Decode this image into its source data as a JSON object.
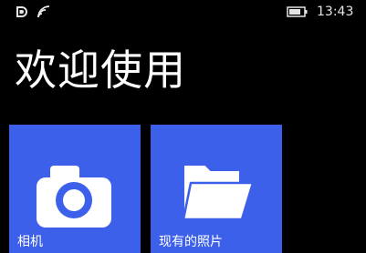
{
  "status_bar": {
    "icons": [
      "nfc-icon",
      "wifi-icon",
      "battery-icon"
    ],
    "time": "13:43"
  },
  "page": {
    "title": "欢迎使用"
  },
  "tiles": [
    {
      "label": "相机",
      "icon": "camera-icon"
    },
    {
      "label": "现有的照片",
      "icon": "folder-icon"
    }
  ],
  "colors": {
    "background": "#000000",
    "tile_accent": "#3d60ea",
    "text": "#ffffff"
  }
}
